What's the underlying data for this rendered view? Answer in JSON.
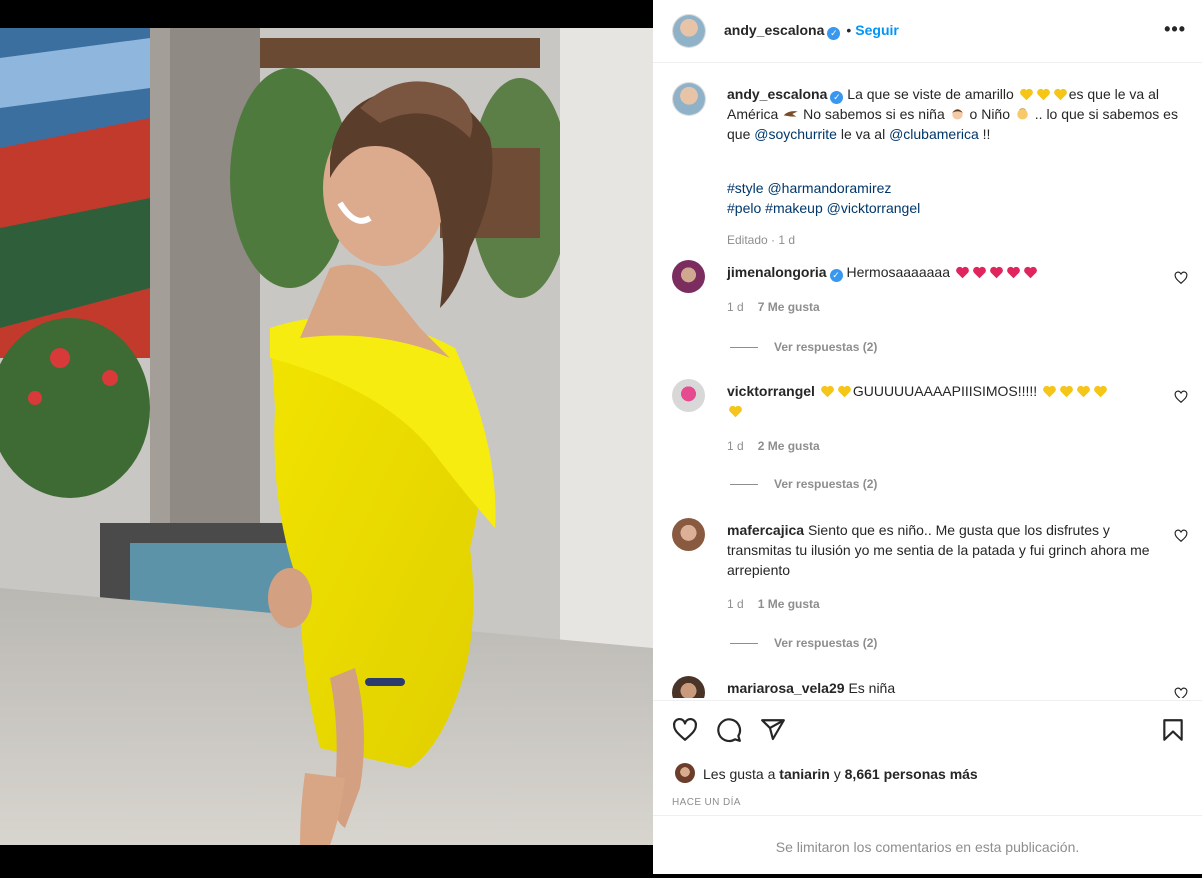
{
  "post": {
    "author": "andy_escalona",
    "follow_label": "Seguir",
    "separator": "•",
    "more_label": "•••"
  },
  "caption": {
    "username": "andy_escalona",
    "text_1": "La que se viste de amarillo ",
    "text_2": "es que le va al América ",
    "text_3": " No sabemos si es niña ",
    "text_4": " o Niño ",
    "text_5": " .. lo que si sabemos es que ",
    "mention_1": "@soychurrite",
    "text_6": " le va al ",
    "mention_2": "@clubamerica",
    "text_7": " !!",
    "line_2a": "#style",
    "line_2b": "@harmandoramirez",
    "line_3a": "#pelo",
    "line_3b": "#makeup",
    "line_3c": "@vicktorrangel",
    "edited": "Editado",
    "edited_sep": "·",
    "edited_time": "1 d"
  },
  "comments": [
    {
      "username": "jimenalongoria",
      "verified": true,
      "text": "Hermosaaaaaaa",
      "time": "1 d",
      "likes": "7 Me gusta",
      "replies": "Ver respuestas (2)"
    },
    {
      "username": "vicktorrangel",
      "text_a": "GUUUUUAAAAPIIISIMOS!!!!!",
      "time": "1 d",
      "likes": "2 Me gusta",
      "replies": "Ver respuestas (2)"
    },
    {
      "username": "mafercajica",
      "text": "Siento que es niño.. Me gusta que los disfrutes y transmitas tu ilusión yo me sentia de la patada y fui grinch ahora me arrepiento",
      "time": "1 d",
      "likes": "1 Me gusta",
      "replies": "Ver respuestas (2)"
    },
    {
      "username": "mariarosa_vela29",
      "text": "Es niña"
    }
  ],
  "likes": {
    "prefix": "Les gusta a ",
    "user": "taniarin",
    "middle": " y ",
    "count": "8,661 personas más"
  },
  "time_ago": "HACE UN DÍA",
  "limited_comments": "Se limitaron los comentarios en esta publicación.",
  "icons": {
    "like": "heart-outline-icon",
    "comment": "comment-bubble-icon",
    "share": "paper-plane-icon",
    "save": "bookmark-icon",
    "more": "ellipsis-icon",
    "verified": "verified-badge-icon"
  },
  "colors": {
    "link": "#00376b",
    "follow": "#0095f6",
    "muted": "#8e8e8e",
    "heart_red": "#ed4956",
    "yellow_heart": "#f5c518"
  }
}
